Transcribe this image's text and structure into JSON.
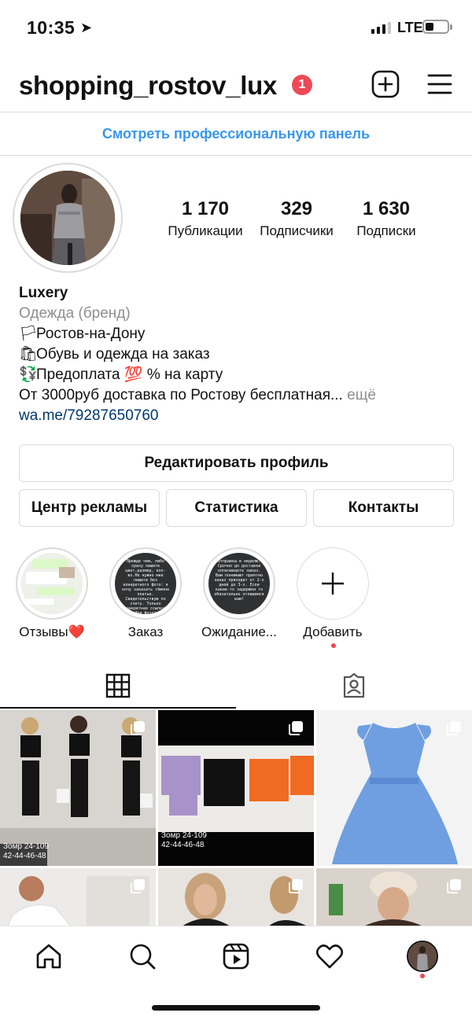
{
  "status_bar": {
    "time": "10:35",
    "location_glyph": "➤",
    "network": "LTE",
    "signal_bars_filled": 3,
    "signal_bars_total": 4
  },
  "header": {
    "username": "shopping_rostov_lux",
    "notification_count": "1",
    "icons": [
      "new-post-icon",
      "menu-icon"
    ]
  },
  "pro_panel": {
    "label": "Смотреть профессиональную панель",
    "color": "#3897f0"
  },
  "profile": {
    "stats": [
      {
        "value": "1 170",
        "label": "Публикации"
      },
      {
        "value": "329",
        "label": "Подписчики"
      },
      {
        "value": "1 630",
        "label": "Подписки"
      }
    ],
    "name": "Luxery",
    "category": "Одежда (бренд)",
    "bio_lines": [
      {
        "emoji": "🏳",
        "text": "Ростов-на-Дону"
      },
      {
        "emoji": "🛍",
        "text": "Обувь и одежда на заказ"
      },
      {
        "emoji": "💱",
        "text": "Предоплата 💯 % на карту"
      }
    ],
    "bio_last": "От 3000руб доставка по Ростову бесплатная...",
    "more": " ещё",
    "link": "wa.me/79287650760"
  },
  "buttons": {
    "edit_profile": "Редактировать профиль",
    "ad_center": "Центр рекламы",
    "statistics": "Статистика",
    "contacts": "Контакты"
  },
  "highlights": [
    {
      "label": "Отзывы❤️"
    },
    {
      "label": "Заказ"
    },
    {
      "label": "Ожидание..."
    },
    {
      "label": "Добавить"
    }
  ],
  "highlight_texts": {
    "order": "Прежде чем, либо сразу пишите цвет,размер, кол-во.Не нужно мне пишите без конкретного фото: я хочу заказать тёмное платье. Свидетельствую по счету. Только конкретная ссылка? Или фото!",
    "waiting": "Отправка в неделю. Срочно до доставки оплачиваете заказ. Вам понимают приятно заказ приходит от 2-х дней до 3-х. Если какие-то задержки то обязательно отпишемся вам!"
  },
  "tabs": {
    "active": "grid"
  },
  "posts": [
    {
      "caption": "Зомр 24-109\n42-44-46-48",
      "palette": "black-outfits"
    },
    {
      "caption": "Зомр 24-109\n42-44-46-48",
      "palette": "tshirts"
    },
    {
      "caption": "",
      "palette": "blue-dress"
    },
    {
      "caption": "",
      "palette": "white-top"
    },
    {
      "caption": "",
      "palette": "portrait"
    },
    {
      "caption": "",
      "palette": "beanie"
    }
  ],
  "bottom_nav": [
    "home-icon",
    "search-icon",
    "reels-icon",
    "activity-icon",
    "profile-icon"
  ],
  "colors": {
    "accent": "#3897f0",
    "notification": "#ed4956",
    "link": "#00376b",
    "secondary_text": "#8e8e8e",
    "border": "#dbdbdb"
  }
}
